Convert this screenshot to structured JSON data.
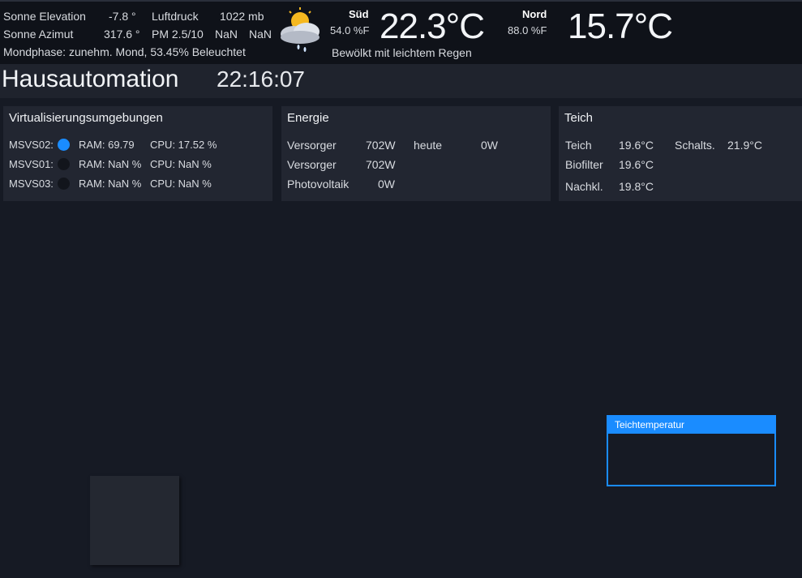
{
  "weather": {
    "sun_elevation_label": "Sonne Elevation",
    "sun_elevation_value": "-7.8 °",
    "sun_azimuth_label": "Sonne Azimut",
    "sun_azimuth_value": "317.6 °",
    "pressure_label": "Luftdruck",
    "pressure_value": "1022 mb",
    "pm_label": "PM 2.5/10",
    "pm_value_1": "NaN",
    "pm_value_2": "NaN",
    "moon_phase": "Mondphase: zunehm. Mond, 53.45% Beleuchtet",
    "condition": "Bewölkt mit leichtem Regen",
    "south_label": "Süd",
    "south_humidity": "54.0 %F",
    "south_temp": "22.3°C",
    "north_label": "Nord",
    "north_humidity": "88.0 %F",
    "north_temp": "15.7°C",
    "icon": "cloud-sun-rain-icon"
  },
  "header": {
    "title": "Hausautomation",
    "time": "22:16:07"
  },
  "virtualization": {
    "title": "Virtualisierungsumgebungen",
    "rows": [
      {
        "name": "MSVS02:",
        "status": "on",
        "ram": "RAM: 69.79",
        "cpu": "CPU: 17.52 %"
      },
      {
        "name": "MSVS01:",
        "status": "off",
        "ram": "RAM: NaN %",
        "cpu": "CPU: NaN %"
      },
      {
        "name": "MSVS03:",
        "status": "off",
        "ram": "RAM: NaN %",
        "cpu": "CPU: NaN %"
      }
    ]
  },
  "energy": {
    "title": "Energie",
    "row1_label": "Versorger",
    "row1_value": "702W",
    "today_label": "heute",
    "today_value": "0W",
    "row2_label": "Versorger",
    "row2_value": "702W",
    "row3_label": "Photovoltaik",
    "row3_value": "0W"
  },
  "pond": {
    "title": "Teich",
    "pond_label": "Teich",
    "pond_value": "19.6°C",
    "switch_label": "Schalts.",
    "switch_value": "21.9°C",
    "biofilter_label": "Biofilter",
    "biofilter_value": "19.6°C",
    "clarifier_label": "Nachkl.",
    "clarifier_value": "19.8°C"
  },
  "popup": {
    "title": "Teichtemperatur"
  },
  "colors": {
    "accent": "#1a8cff",
    "background": "#161a24",
    "panel": "#222631"
  }
}
